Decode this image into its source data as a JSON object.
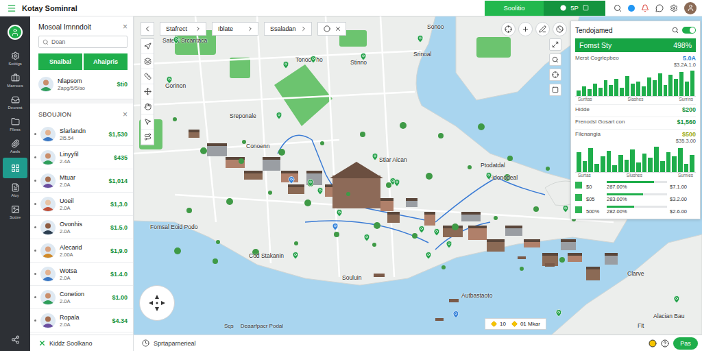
{
  "app": {
    "title": "Kotay Sominral"
  },
  "top_bar": {
    "buttons": [
      {
        "label": "Soolitio"
      },
      {
        "label": "5P"
      }
    ]
  },
  "rail": {
    "items": [
      {
        "label": "Sotitigs",
        "selected": false
      },
      {
        "label": "Marnoes",
        "selected": false
      },
      {
        "label": "Deorest",
        "selected": false
      },
      {
        "label": "Flless",
        "selected": false
      },
      {
        "label": "Aasls",
        "selected": false
      },
      {
        "selected": true
      },
      {
        "label": "Aloy",
        "selected": false
      },
      {
        "label": "Sottre",
        "selected": false
      }
    ]
  },
  "left_panel": {
    "title": "Mosoal Imnndoit",
    "close": "×",
    "search": {
      "placeholder": "Doan"
    },
    "buttons": [
      "Snaibal",
      "Ahaipris"
    ],
    "profile": {
      "name": "Nlapsom",
      "sub": "Zapg/5/5/ao",
      "price": "$ti0"
    }
  },
  "section": {
    "title": "SBOUJION",
    "close": "×",
    "rows": [
      {
        "name": "Slarlandn",
        "sub": "2l5.54",
        "price": "$1,530"
      },
      {
        "name": "Linyyfil",
        "sub": "2.4A",
        "price": "$435"
      },
      {
        "name": "Mtuar",
        "sub": "2.0A",
        "price": "$1,014"
      },
      {
        "name": "Uoeil",
        "sub": "2.0A",
        "price": "$1,3.0"
      },
      {
        "name": "Ovonhis",
        "sub": "2.0A",
        "price": "$1.5.0"
      },
      {
        "name": "Alecarid",
        "sub": "2.00A",
        "price": "$1,9.0"
      },
      {
        "name": "Wotsa",
        "sub": "2.0A",
        "price": "$1.4.0"
      },
      {
        "name": "Conetion",
        "sub": "2.0A",
        "price": "$1.00"
      },
      {
        "name": "Ropala",
        "sub": "2.0A",
        "price": "$4.34"
      }
    ]
  },
  "footer": {
    "label": "Kiddz Soolkano"
  },
  "map": {
    "toolbar": {
      "pills": [
        "Stafrect",
        "Iblate",
        "Ssaladan"
      ]
    },
    "labels": [
      "Sateot Srcantaca",
      "Gorinon",
      "Tonodo ho",
      "Stinno",
      "Sonoo",
      "Srinoal",
      "Sreponale",
      "Conoenn",
      "Stiar Aican",
      "Ptodatdal",
      "Fidonodeal",
      "Fomsal Eoid Podo",
      "Cod Stakanin",
      "Souluin",
      "Autbastaoto",
      "Clarve",
      "Alacian Bau",
      "Fit"
    ],
    "scale": {
      "unit": "Sqs",
      "label": "Deaarfpacr Podal"
    },
    "legend": [
      "10",
      "01 Mkar"
    ]
  },
  "info_panel": {
    "title": "Tendojamed",
    "toggle": {
      "on": true
    },
    "header": {
      "label": "Fomst Sty",
      "value": "498%"
    },
    "metric": {
      "label": "Merst Cogrlepbeo",
      "value": "5.0A",
      "sub": "$3.2A.1.0"
    },
    "chart1": {
      "values": [
        20,
        35,
        25,
        45,
        30,
        55,
        40,
        60,
        30,
        70,
        45,
        50,
        35,
        65,
        55,
        80,
        40,
        75,
        60,
        85,
        50,
        90
      ],
      "ticks": [
        "Surttas",
        "Slashes",
        "Surrins"
      ]
    },
    "rows": [
      {
        "label": "Hidde",
        "value": "$200"
      },
      {
        "label": "Frenodsl Gosart con",
        "value": "$1,560"
      },
      {
        "label": "Filenangia",
        "value": "$500",
        "sub": "$35.3.00"
      }
    ],
    "chart2": {
      "values": [
        70,
        40,
        85,
        30,
        55,
        75,
        25,
        60,
        45,
        80,
        35,
        65,
        50,
        90,
        40,
        70,
        55,
        85,
        30,
        60
      ],
      "ticks": [
        "Surtas",
        "Slushes",
        "Surnies"
      ]
    },
    "progress": [
      {
        "label": "$0",
        "percent": "287.00%",
        "value": "$7.1.00",
        "level": 0.78
      },
      {
        "label": "$05",
        "percent": "283.00%",
        "value": "$3.2.00",
        "level": 0.6
      },
      {
        "label": "500%",
        "percent": "282.00%",
        "value": "$2.6.00",
        "level": 0.45
      }
    ]
  },
  "bottom_bar": {
    "label": "Sprtaparnerieal",
    "button": "Pas"
  }
}
